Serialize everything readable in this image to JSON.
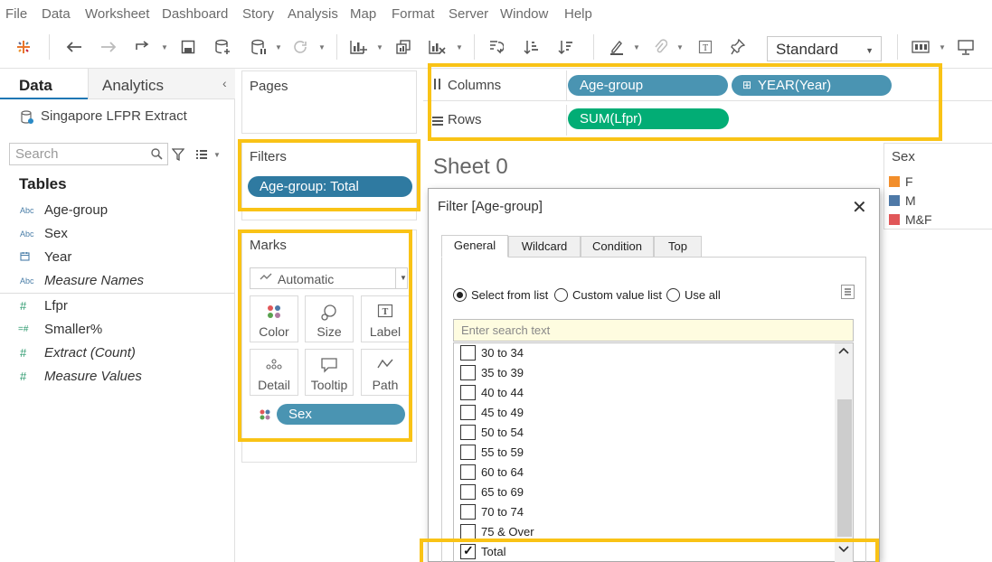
{
  "menu": [
    "File",
    "Data",
    "Worksheet",
    "Dashboard",
    "Story",
    "Analysis",
    "Map",
    "Format",
    "Server",
    "Window",
    "Help"
  ],
  "toolbar": {
    "fit_mode": "Standard"
  },
  "data_pane": {
    "tab_data": "Data",
    "tab_analytics": "Analytics",
    "collapse_glyph": "‹",
    "datasource": "Singapore LFPR Extract",
    "search_placeholder": "Search",
    "tables_title": "Tables",
    "dimensions": [
      {
        "icon": "Abc",
        "name": "Age-group",
        "italic": false
      },
      {
        "icon": "Abc",
        "name": "Sex",
        "italic": false
      },
      {
        "icon": "date",
        "name": "Year",
        "italic": false
      },
      {
        "icon": "Abc",
        "name": "Measure Names",
        "italic": true
      }
    ],
    "measures": [
      {
        "icon": "#",
        "name": "Lfpr",
        "italic": false
      },
      {
        "icon": "=#",
        "name": "Smaller%",
        "italic": false
      },
      {
        "icon": "#",
        "name": "Extract (Count)",
        "italic": true
      },
      {
        "icon": "#",
        "name": "Measure Values",
        "italic": true
      }
    ]
  },
  "pages": {
    "title": "Pages"
  },
  "filters": {
    "title": "Filters",
    "pill": "Age-group: Total"
  },
  "marks": {
    "title": "Marks",
    "mark_type": "Automatic",
    "buttons": [
      "Color",
      "Size",
      "Label",
      "Detail",
      "Tooltip",
      "Path"
    ],
    "color_pill": "Sex"
  },
  "columns": {
    "label": "Columns",
    "pills": [
      "Age-group",
      "YEAR(Year)"
    ],
    "plus": "⊞"
  },
  "rows": {
    "label": "Rows",
    "pills": [
      "SUM(Lfpr)"
    ]
  },
  "sheet_title": "Sheet 0",
  "legend": {
    "title": "Sex",
    "items": [
      {
        "label": "F",
        "color": "#f28e2b"
      },
      {
        "label": "M",
        "color": "#4e79a7"
      },
      {
        "label": "M&F",
        "color": "#e15759"
      }
    ]
  },
  "filter_dialog": {
    "title": "Filter [Age-group]",
    "close_glyph": "✕",
    "tabs": [
      "General",
      "Wildcard",
      "Condition",
      "Top"
    ],
    "radio_options": [
      "Select from list",
      "Custom value list",
      "Use all"
    ],
    "search_placeholder": "Enter search text",
    "items": [
      {
        "label": "30 to 34",
        "checked": false
      },
      {
        "label": "35 to 39",
        "checked": false
      },
      {
        "label": "40 to 44",
        "checked": false
      },
      {
        "label": "45 to 49",
        "checked": false
      },
      {
        "label": "50 to 54",
        "checked": false
      },
      {
        "label": "55 to 59",
        "checked": false
      },
      {
        "label": "60 to 64",
        "checked": false
      },
      {
        "label": "65 to 69",
        "checked": false
      },
      {
        "label": "70 to 74",
        "checked": false
      },
      {
        "label": "75 & Over",
        "checked": false
      },
      {
        "label": "Total",
        "checked": true
      }
    ],
    "scroll_up": "⌃",
    "scroll_down": "⌄"
  },
  "colors": {
    "highlight": "#f9c316",
    "dim_pill": "#4a94b2",
    "measure_pill": "#02ad75",
    "filter_pill": "#2f7aa1",
    "accent_tab": "#1f77b4"
  }
}
